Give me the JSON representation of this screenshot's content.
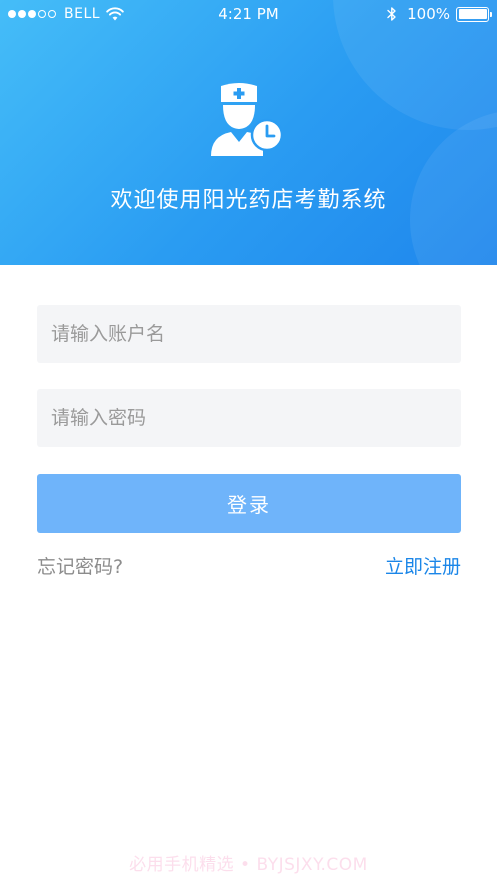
{
  "status_bar": {
    "carrier": "BELL",
    "time": "4:21 PM",
    "battery": "100%",
    "signal_bars_filled": 3,
    "signal_bars_total": 5
  },
  "header": {
    "icon": "pharmacist-clock-icon",
    "welcome_text": "欢迎使用阳光药店考勤系统",
    "gradient_start": "#45bdf8",
    "gradient_end": "#1f86ec"
  },
  "form": {
    "username": {
      "placeholder": "请输入账户名",
      "value": ""
    },
    "password": {
      "placeholder": "请输入密码",
      "value": ""
    },
    "login_label": "登录",
    "forgot_label": "忘记密码?",
    "register_label": "立即注册"
  },
  "colors": {
    "accent": "#1b86e8",
    "button": "#6fb4fa",
    "input_bg": "#f4f5f7"
  },
  "watermark": "必用手机精选 • BYJSJXY.COM"
}
